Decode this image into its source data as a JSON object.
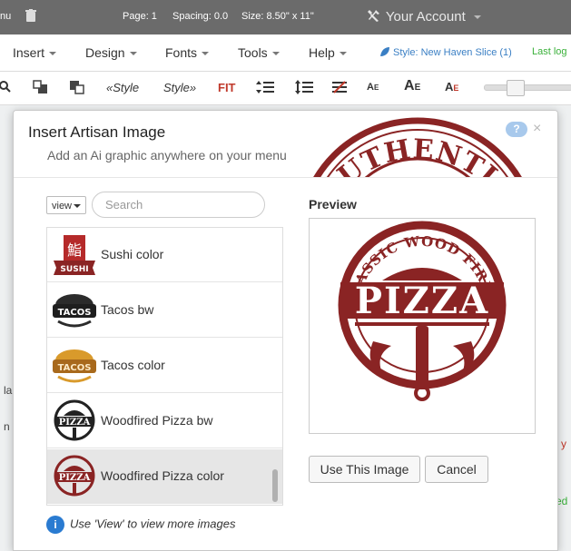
{
  "topbar": {
    "left_fragment": "nu",
    "page": "Page: 1",
    "spacing": "Spacing: 0.0",
    "size": "Size: 8.50\" x 11\"",
    "account": "Your Account"
  },
  "menubar": {
    "items": [
      "Insert",
      "Design",
      "Fonts",
      "Tools",
      "Help"
    ],
    "style_link": "Style: New Haven Slice (1)",
    "last_fragment": "Last log"
  },
  "toolbar": {
    "style_left": "«Style",
    "style_right": "Style»",
    "fit": "FIT"
  },
  "background": {
    "left_la": "la",
    "left_n": "n",
    "right_y": "y",
    "right_ed": "ed"
  },
  "dialog": {
    "title": "Insert Artisan Image",
    "subtitle": "Add an Ai graphic anywhere on your menu",
    "help_label": "?",
    "close_label": "×",
    "stamp_text": "AUTHENTIC",
    "view_label": "view",
    "search_placeholder": "Search",
    "items": [
      {
        "label": "Sushi color",
        "icon": "sushi-color-logo"
      },
      {
        "label": "Tacos bw",
        "icon": "tacos-bw-logo"
      },
      {
        "label": "Tacos color",
        "icon": "tacos-color-logo"
      },
      {
        "label": "Woodfired Pizza bw",
        "icon": "pizza-bw-logo"
      },
      {
        "label": "Woodfired Pizza color",
        "icon": "pizza-color-logo",
        "selected": true
      }
    ],
    "info_icon": "i",
    "info_text": "Use 'View' to view more images",
    "preview_label": "Preview",
    "preview_image": {
      "arc_text": "CLASSIC WOOD FIRED",
      "main_text": "PIZZA",
      "color": "#8a2424"
    },
    "use_button": "Use This Image",
    "cancel_button": "Cancel"
  },
  "colors": {
    "topbar": "#6b6b6b",
    "accent_blue": "#2a7bd1",
    "brand_red": "#8a2424",
    "fit_red": "#c0392b",
    "green": "#3ab03a"
  }
}
